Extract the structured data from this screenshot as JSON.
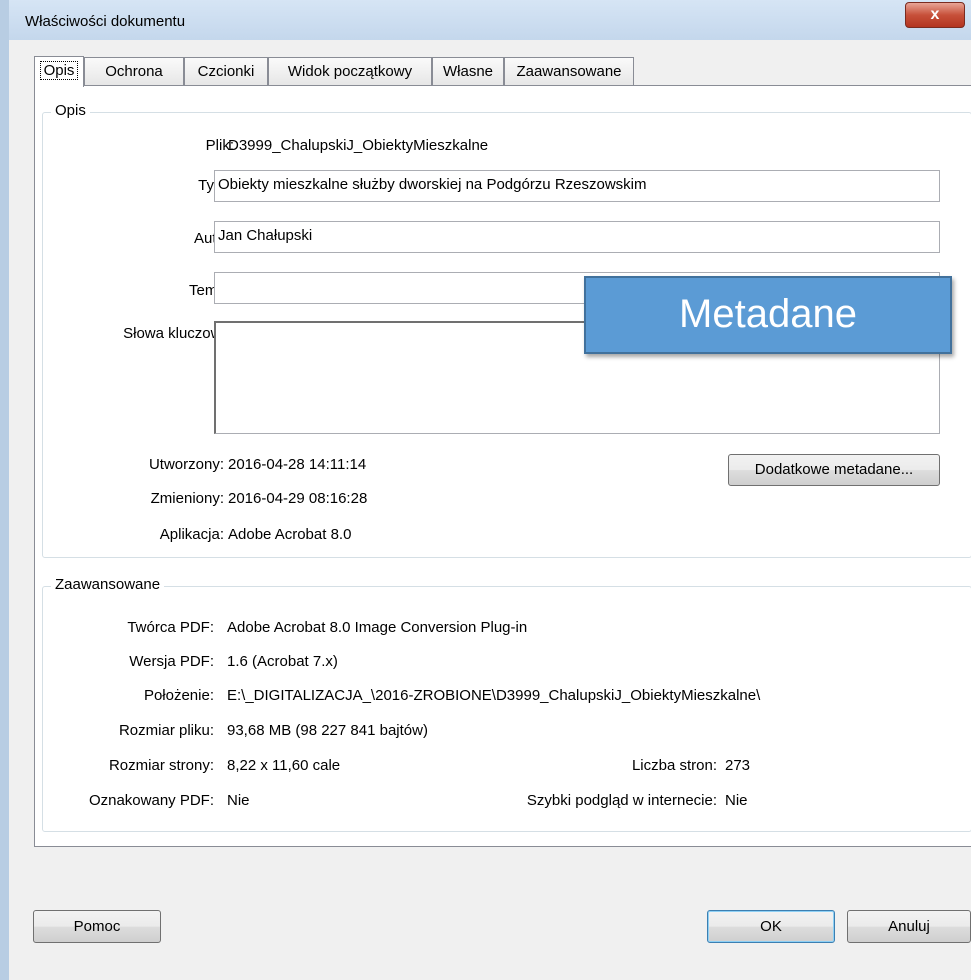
{
  "window": {
    "title": "Właściwości dokumentu",
    "close_symbol": "x"
  },
  "tabs": [
    {
      "label": "Opis",
      "active": true
    },
    {
      "label": "Ochrona"
    },
    {
      "label": "Czcionki"
    },
    {
      "label": "Widok początkowy"
    },
    {
      "label": "Własne"
    },
    {
      "label": "Zaawansowane"
    }
  ],
  "description": {
    "legend": "Opis",
    "file_label": "Plik:",
    "file_value": "D3999_ChalupskiJ_ObiektyMieszkalne",
    "title_label": "Tytuł:",
    "title_value": "Obiekty mieszkalne służby dworskiej na Podgórzu Rzeszowskim",
    "author_label": "Autor:",
    "author_value": "Jan Chałupski",
    "subject_label": "Temat:",
    "subject_value": "",
    "keywords_label": "Słowa kluczowe:",
    "keywords_value": "",
    "created_label": "Utworzony:",
    "created_value": "2016-04-28 14:11:14",
    "modified_label": "Zmieniony:",
    "modified_value": "2016-04-29 08:16:28",
    "app_label": "Aplikacja:",
    "app_value": "Adobe Acrobat 8.0",
    "more_metadata_button": "Dodatkowe metadane..."
  },
  "advanced": {
    "legend": "Zaawansowane",
    "producer_label": "Twórca PDF:",
    "producer_value": "Adobe Acrobat 8.0 Image Conversion Plug-in",
    "version_label": "Wersja PDF:",
    "version_value": "1.6 (Acrobat 7.x)",
    "location_label": "Położenie:",
    "location_value": "E:\\_DIGITALIZACJA_\\2016-ZROBIONE\\D3999_ChalupskiJ_ObiektyMieszkalne\\",
    "filesize_label": "Rozmiar pliku:",
    "filesize_value": "93,68 MB (98 227 841 bajtów)",
    "pagesize_label": "Rozmiar strony:",
    "pagesize_value": "8,22 x 11,60 cale",
    "pagecount_label": "Liczba stron:",
    "pagecount_value": "273",
    "tagged_label": "Oznakowany PDF:",
    "tagged_value": "Nie",
    "fastweb_label": "Szybki podgląd w internecie:",
    "fastweb_value": "Nie"
  },
  "overlay": {
    "text": "Metadane",
    "color": "#5b9bd5"
  },
  "buttons": {
    "help": "Pomoc",
    "ok": "OK",
    "cancel": "Anuluj"
  }
}
